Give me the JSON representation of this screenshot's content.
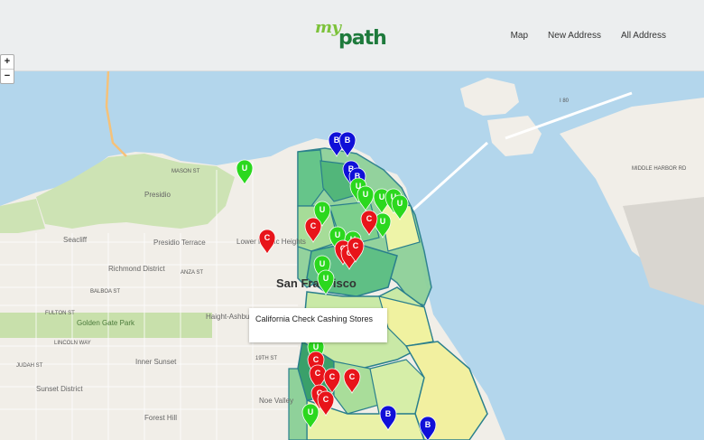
{
  "app": {
    "logo_my": "my",
    "logo_path": "path"
  },
  "nav": {
    "items": [
      "Map",
      "New Address",
      "All Address"
    ]
  },
  "zoom": {
    "in": "+",
    "out": "−"
  },
  "popup": {
    "text": "California Check Cashing Stores"
  },
  "map_labels": [
    {
      "text": "San Francisco",
      "kind": "city"
    },
    {
      "text": "Presidio"
    },
    {
      "text": "Presidio Terrace"
    },
    {
      "text": "Seacliff"
    },
    {
      "text": "Lower Pacific Heights"
    },
    {
      "text": "Richmond District"
    },
    {
      "text": "Golden Gate Park"
    },
    {
      "text": "Inner Sunset"
    },
    {
      "text": "Sunset District"
    },
    {
      "text": "Haight-Ashbury"
    },
    {
      "text": "Noe Valley"
    },
    {
      "text": "Forest Hill"
    },
    {
      "text": "MIDDLE HARBOR RD"
    },
    {
      "text": "I 80"
    },
    {
      "text": "ANZA ST"
    },
    {
      "text": "BALBOA ST"
    },
    {
      "text": "FULTON ST"
    },
    {
      "text": "LINCOLN WAY"
    },
    {
      "text": "JUDAH ST"
    },
    {
      "text": "19TH ST"
    },
    {
      "text": "MASON ST"
    }
  ],
  "marker_colors": {
    "B": "#1010d8",
    "C": "#e8141a",
    "U": "#2bd81e"
  },
  "markers": [
    {
      "type": "B"
    },
    {
      "type": "B"
    },
    {
      "type": "B"
    },
    {
      "type": "B"
    },
    {
      "type": "B"
    },
    {
      "type": "B"
    },
    {
      "type": "U"
    },
    {
      "type": "U"
    },
    {
      "type": "U"
    },
    {
      "type": "U"
    },
    {
      "type": "U"
    },
    {
      "type": "U"
    },
    {
      "type": "U"
    },
    {
      "type": "U"
    },
    {
      "type": "U"
    },
    {
      "type": "U"
    },
    {
      "type": "U"
    },
    {
      "type": "U"
    },
    {
      "type": "U"
    },
    {
      "type": "U"
    },
    {
      "type": "C"
    },
    {
      "type": "C"
    },
    {
      "type": "C"
    },
    {
      "type": "C"
    },
    {
      "type": "C"
    },
    {
      "type": "C"
    },
    {
      "type": "C"
    },
    {
      "type": "C"
    },
    {
      "type": "C"
    },
    {
      "type": "C"
    },
    {
      "type": "C"
    },
    {
      "type": "C"
    }
  ]
}
